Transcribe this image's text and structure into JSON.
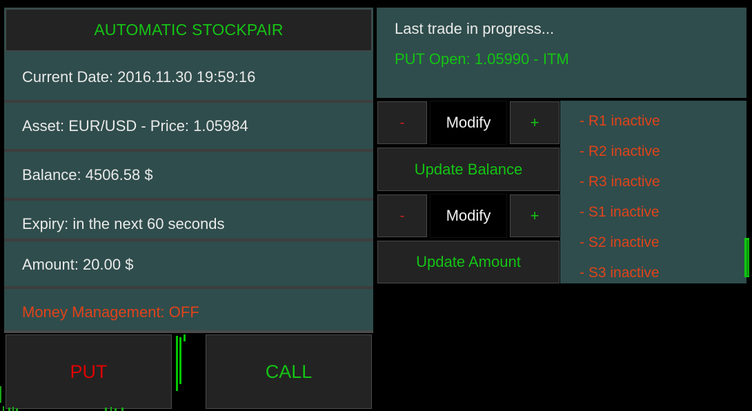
{
  "app": {
    "title": "AUTOMATIC STOCKPAIR",
    "accent_green": "#14c414",
    "accent_red": "#e0431a",
    "panel_teal": "#2f4d4c",
    "panel_dark": "#232323"
  },
  "left_panel": {
    "rows": [
      {
        "label": "Current Date:",
        "value": "2016.11.30 19:59:16",
        "text": "Current Date:  2016.11.30 19:59:16",
        "state": "normal"
      },
      {
        "label": "Asset:",
        "value": "EUR/USD  -  Price: 1.05984",
        "text": "Asset:  EUR/USD  -  Price: 1.05984",
        "state": "normal"
      },
      {
        "label": "Balance:",
        "value": "4506.58 $",
        "text": "Balance:  4506.58 $",
        "state": "normal"
      },
      {
        "label": "Expiry:",
        "value": "in the next 60 seconds",
        "text": "Expiry:  in the next 60 seconds",
        "state": "normal"
      },
      {
        "label": "Amount:",
        "value": "20.00 $",
        "text": "Amount:  20.00 $",
        "state": "normal"
      },
      {
        "label": "Money Management:",
        "value": "OFF",
        "text": "Money Management:  OFF",
        "state": "warn"
      }
    ]
  },
  "trade_buttons": {
    "put": "PUT",
    "call": "CALL"
  },
  "status_panel": {
    "line1": "Last trade in progress...",
    "line2": "PUT Open:  1.05990  -  ITM"
  },
  "controls": {
    "balance_minus": "-",
    "balance_modify": "Modify",
    "balance_plus": "+",
    "update_balance": "Update Balance",
    "amount_minus": "-",
    "amount_modify": "Modify",
    "amount_plus": "+",
    "update_amount": "Update Amount"
  },
  "rs_panel": {
    "items": [
      "- R1 inactive",
      "- R2 inactive",
      "- R3 inactive",
      "- S1 inactive",
      "- S2 inactive",
      "- S3 inactive"
    ]
  }
}
